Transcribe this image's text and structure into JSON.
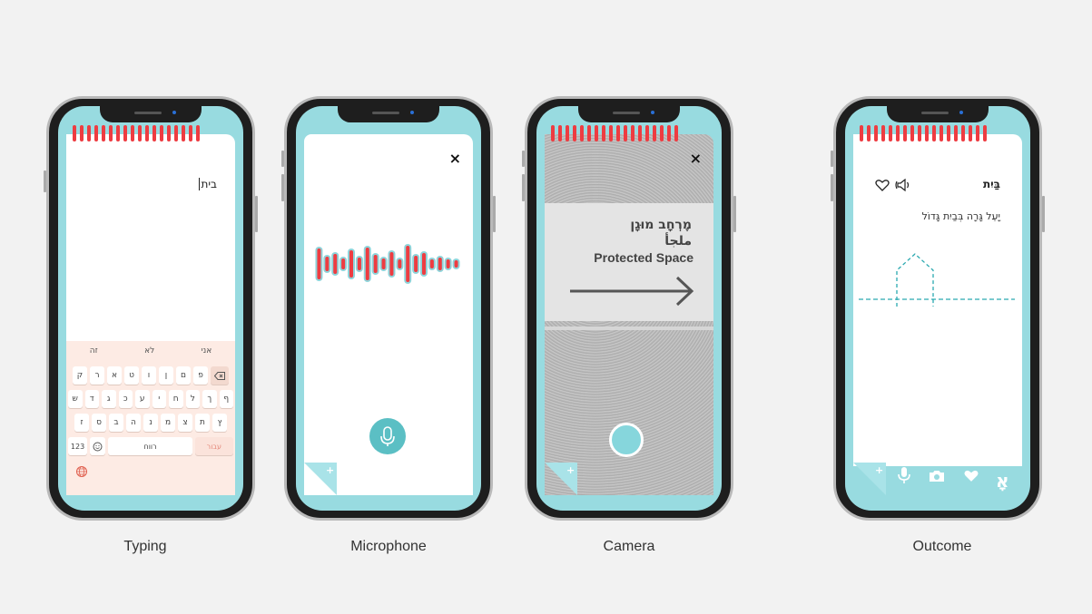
{
  "colors": {
    "accent": "#98dbe0",
    "rings": "#ee3c41",
    "teal": "#5bbfc4",
    "keyboard": "#fdebe4"
  },
  "captions": {
    "typing": "Typing",
    "microphone": "Microphone",
    "camera": "Camera",
    "outcome": "Outcome"
  },
  "typing": {
    "input_value": "בית",
    "suggestions": [
      "אני",
      "לא",
      "זה"
    ],
    "row1": [
      "פ",
      "ם",
      "ן",
      "ו",
      "ט",
      "א",
      "ר",
      "ק"
    ],
    "row2": [
      "ף",
      "ך",
      "ל",
      "ח",
      "י",
      "ע",
      "כ",
      "ג",
      "ד",
      "ש"
    ],
    "row3": [
      "ץ",
      "ת",
      "צ",
      "מ",
      "נ",
      "ה",
      "ב",
      "ס",
      "ז"
    ],
    "numbers_key": "123",
    "space_key": "רווח",
    "enter_key": "עבור"
  },
  "microphone": {
    "close_label": "×"
  },
  "camera": {
    "close_label": "×",
    "sign_hebrew": "מֶרְחָב מוּגָן",
    "sign_arabic": "ملجأ",
    "sign_english": "Protected Space"
  },
  "outcome": {
    "word": "בַּיִת",
    "sentence": "יָעֵל גָּרָה בְּבַיִת גָּדוֹל",
    "tab_letter": "אָ",
    "icons": [
      "heart-icon",
      "speaker-icon",
      "mic-icon",
      "camera-icon",
      "heart-filled-icon"
    ]
  }
}
